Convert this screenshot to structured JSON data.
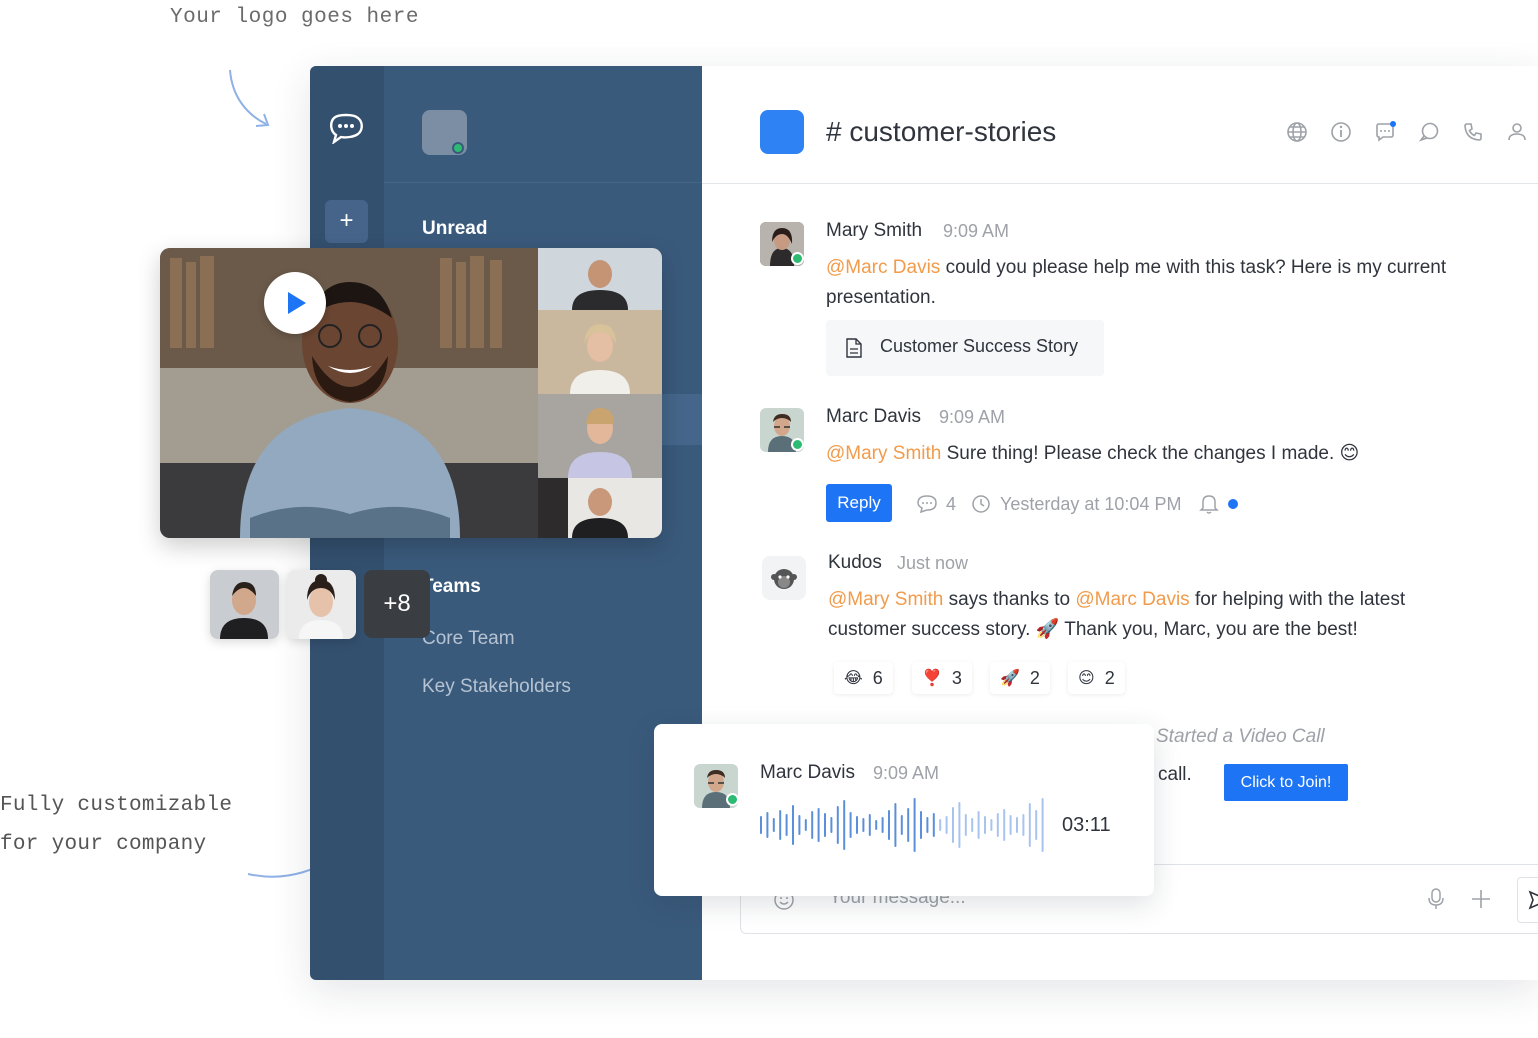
{
  "annotations": {
    "logo_note": "Your logo goes here",
    "custom_note_line1": "Fully customizable",
    "custom_note_line2": "for your company"
  },
  "sidebar": {
    "unread_label": "Unread",
    "teams_label": "Teams",
    "teams_items": [
      "Core Team",
      "Key Stakeholders"
    ],
    "add_label": "+"
  },
  "header": {
    "room_title": "# customer-stories",
    "icons": [
      "globe-icon",
      "info-icon",
      "threads-icon",
      "discussion-icon",
      "phone-icon",
      "members-icon"
    ]
  },
  "messages": [
    {
      "name": "Mary Smith",
      "time": "9:09 AM",
      "mention": "@Marc Davis",
      "text_line1": " could you please help me with this task? Here is my current",
      "text_line2": "presentation.",
      "attachment": "Customer Success Story"
    },
    {
      "name": "Marc Davis",
      "time": "9:09 AM",
      "mention": "@Mary Smith",
      "text": " Sure thing! Please check the changes I made.",
      "emoji": "😊",
      "reply_label": "Reply",
      "thread_count": "4",
      "last_reply": "Yesterday at 10:04 PM"
    },
    {
      "name": "Kudos",
      "time": "Just now",
      "mention1": "@Mary Smith",
      "text1": " says thanks to ",
      "mention2": "@Marc Davis",
      "text2": " for helping with the latest",
      "line2": "customer success story. 🚀 Thank you, Marc, you are the best!",
      "reactions": [
        {
          "emoji": "😂",
          "count": "6"
        },
        {
          "emoji": "❣️",
          "count": "3"
        },
        {
          "emoji": "🚀",
          "count": "2"
        },
        {
          "emoji": "😊",
          "count": "2"
        }
      ]
    }
  ],
  "video_call": {
    "started_text": "Started a Video Call",
    "call_text": "call.",
    "join_label": "Click to Join!",
    "more_participants": "+8"
  },
  "audio": {
    "name": "Marc Davis",
    "time": "9:09 AM",
    "duration": "03:11"
  },
  "composer": {
    "placeholder": "Your message..."
  },
  "colors": {
    "rail": "#33506f",
    "sidebar": "#3a5a7c",
    "accent": "#1d74f5",
    "mention": "#f19b4b",
    "online": "#2dbb74"
  }
}
